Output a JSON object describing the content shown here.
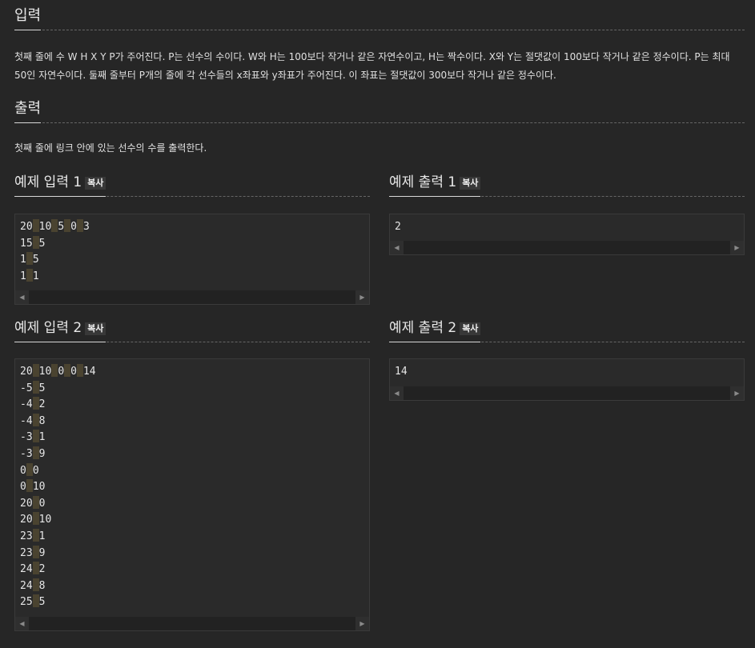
{
  "input_section": {
    "title": "입력",
    "description": "첫째 줄에 수 W H X Y P가 주어진다. P는 선수의 수이다. W와 H는 100보다 작거나 같은 자연수이고, H는 짝수이다. X와 Y는 절댓값이 100보다 작거나 같은 정수이다. P는 최대 50인 자연수이다. 둘째 줄부터 P개의 줄에 각 선수들의 x좌표와 y좌표가 주어진다. 이 좌표는 절댓값이 300보다 작거나 같은 정수이다."
  },
  "output_section": {
    "title": "출력",
    "description": "첫째 줄에 링크 안에 있는 선수의 수를 출력한다."
  },
  "copy_label": "복사",
  "examples": [
    {
      "input_title": "예제 입력 1",
      "input_lines": [
        [
          "20",
          "10",
          "5",
          "0",
          "3"
        ],
        [
          "15",
          "5"
        ],
        [
          "1",
          "5"
        ],
        [
          "1",
          "1"
        ]
      ],
      "output_title": "예제 출력 1",
      "output_lines": [
        [
          "2"
        ]
      ]
    },
    {
      "input_title": "예제 입력 2",
      "input_lines": [
        [
          "20",
          "10",
          "0",
          "0",
          "14"
        ],
        [
          "-5",
          "5"
        ],
        [
          "-4",
          "2"
        ],
        [
          "-4",
          "8"
        ],
        [
          "-3",
          "1"
        ],
        [
          "-3",
          "9"
        ],
        [
          "0",
          "0"
        ],
        [
          "0",
          "10"
        ],
        [
          "20",
          "0"
        ],
        [
          "20",
          "10"
        ],
        [
          "23",
          "1"
        ],
        [
          "23",
          "9"
        ],
        [
          "24",
          "2"
        ],
        [
          "24",
          "8"
        ],
        [
          "25",
          "5"
        ]
      ],
      "output_title": "예제 출력 2",
      "output_lines": [
        [
          "14"
        ]
      ]
    }
  ],
  "icons": {
    "scroll_left": "scroll-left-arrow-icon",
    "scroll_right": "scroll-right-arrow-icon"
  }
}
